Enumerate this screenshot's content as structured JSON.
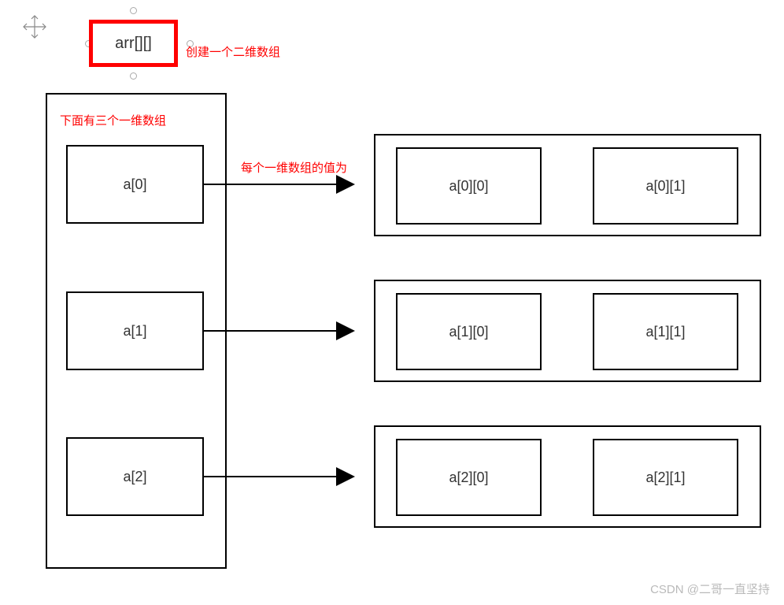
{
  "header": {
    "title": "arr[][]",
    "annotation": "创建一个二维数组"
  },
  "outer": {
    "annotation": "下面有三个一维数组"
  },
  "left_cells": [
    "a[0]",
    "a[1]",
    "a[2]"
  ],
  "arrow_annotation": "每个一维数组的值为",
  "right_rows": [
    [
      "a[0][0]",
      "a[0][1]"
    ],
    [
      "a[1][0]",
      "a[1][1]"
    ],
    [
      "a[2][0]",
      "a[2][1]"
    ]
  ],
  "watermark": "CSDN @二哥一直坚持"
}
